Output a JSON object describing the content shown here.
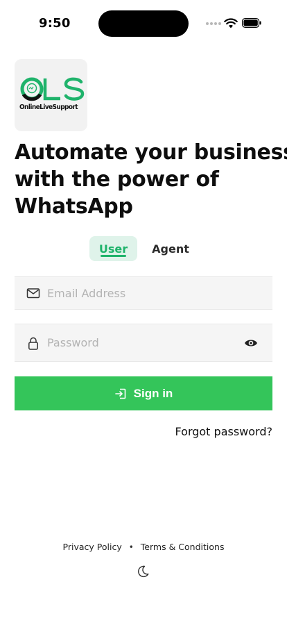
{
  "status_bar": {
    "time": "9:50"
  },
  "logo": {
    "mark": "OLS",
    "tagline": "OnlineLiveSupport",
    "colors": {
      "green": "#1fb36b",
      "dark": "#111111"
    }
  },
  "headline": {
    "lines": [
      "Automate your business",
      "with the power of",
      "WhatsApp"
    ]
  },
  "tabs": {
    "user_label": "User",
    "agent_label": "Agent",
    "active": "User"
  },
  "form": {
    "email": {
      "placeholder": "Email Address",
      "value": "",
      "icon": "mail-icon"
    },
    "password": {
      "placeholder": "Password",
      "value": "",
      "icon": "lock-icon",
      "toggle_icon": "eye-icon"
    },
    "signin_label": "Sign in",
    "signin_icon": "login-icon",
    "forgot_label": "Forgot password?"
  },
  "footer": {
    "privacy_label": "Privacy Policy",
    "separator": "•",
    "terms_label": "Terms & Conditions",
    "theme_icon": "moon-icon"
  },
  "colors": {
    "primary_button": "#34c55a",
    "tab_active_bg": "#dff3ea",
    "tab_active_text": "#1fb36b",
    "input_bg": "#f5f5f5"
  }
}
